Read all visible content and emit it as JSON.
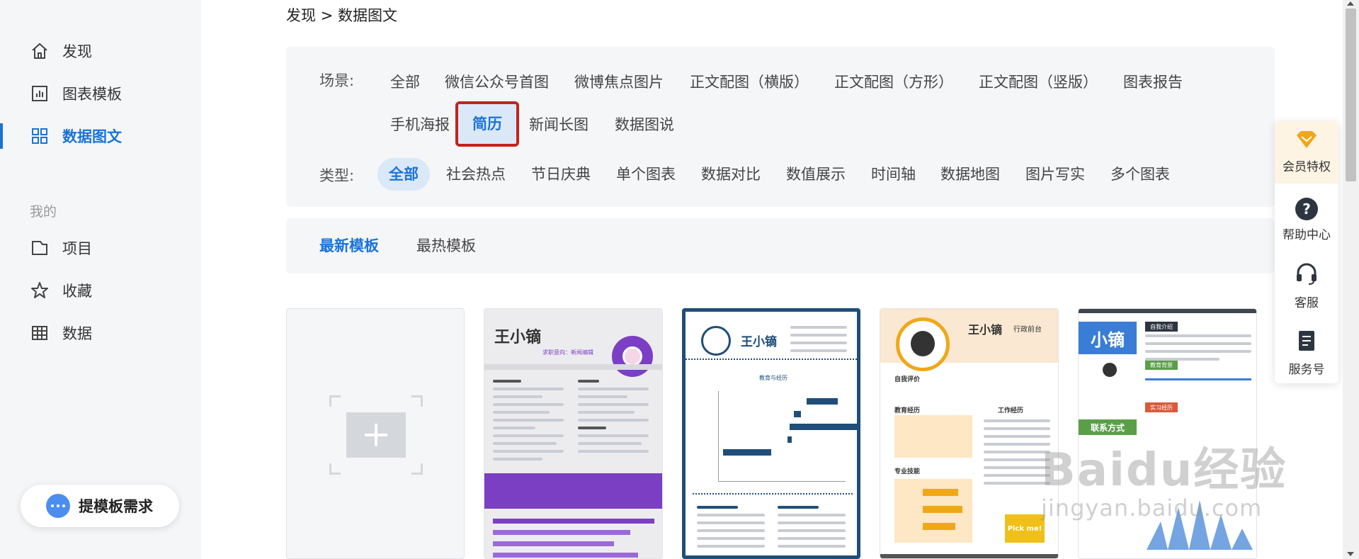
{
  "breadcrumb": {
    "root": "发现",
    "separator": ">",
    "current": "数据图文"
  },
  "sidebar": {
    "items": [
      {
        "label": "发现",
        "icon": "home-icon"
      },
      {
        "label": "图表模板",
        "icon": "chart-icon"
      },
      {
        "label": "数据图文",
        "icon": "grid-icon",
        "active": true
      }
    ],
    "section_title": "我的",
    "my_items": [
      {
        "label": "项目",
        "icon": "folder-icon"
      },
      {
        "label": "收藏",
        "icon": "star-icon"
      },
      {
        "label": "数据",
        "icon": "table-icon"
      }
    ],
    "request_button": "提模板需求"
  },
  "filters": {
    "scene_label": "场景:",
    "scenes": [
      "全部",
      "微信公众号首图",
      "微博焦点图片",
      "正文配图（横版）",
      "正文配图（方形）",
      "正文配图（竖版）",
      "图表报告",
      "手机海报",
      "简历",
      "新闻长图",
      "数据图说"
    ],
    "selected_scene": "简历",
    "type_label": "类型:",
    "types": [
      "全部",
      "社会热点",
      "节日庆典",
      "单个图表",
      "数据对比",
      "数值展示",
      "时间轴",
      "数据地图",
      "图片写实",
      "多个图表"
    ],
    "selected_type": "全部"
  },
  "sort_tabs": {
    "latest": "最新模板",
    "hottest": "最热模板",
    "active": "最新模板"
  },
  "cards": [
    {
      "type": "new"
    },
    {
      "name": "王小镝",
      "subtitle": "求职意向：新闻编辑",
      "theme": "#7b3fc4"
    },
    {
      "name": "王小镝",
      "theme": "#1f4e79",
      "section": "教育与经历"
    },
    {
      "name": "王小镝",
      "tag": "行政前台",
      "theme": "#f0a818",
      "sections": [
        "自我评价",
        "教育经历",
        "工作经历",
        "专业技能"
      ],
      "button": "Pick me!"
    },
    {
      "name": "小镝",
      "theme": "#3a7dd6",
      "sections": [
        "自我介绍",
        "教育背景",
        "实习经历",
        "联系方式"
      ]
    }
  ],
  "float_panel": {
    "items": [
      {
        "label": "会员特权",
        "icon": "diamond-icon"
      },
      {
        "label": "帮助中心",
        "icon": "help-icon"
      },
      {
        "label": "客服",
        "icon": "headset-icon"
      },
      {
        "label": "服务号",
        "icon": "document-icon"
      }
    ]
  },
  "watermark": {
    "main": "Baidu经验",
    "sub": "jingyan.baidu.com"
  },
  "colors": {
    "accent": "#1a73d9",
    "highlight_box": "#c0241c",
    "panel_bg": "#f5f6f8"
  }
}
